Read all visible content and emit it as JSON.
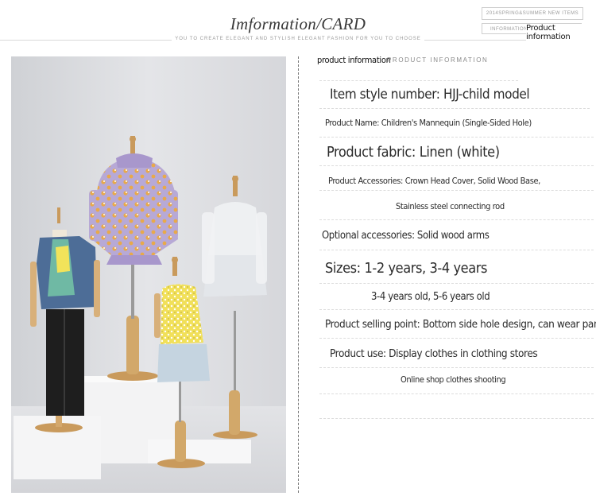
{
  "header": {
    "title": "Imformation/CARD",
    "subtitle": "YOU TO CREATE ELEGANT AND STYLISH ELEGANT FASHION FOR YOU TO CHOOSE",
    "season_tag": "2014SPRING&SUMMER NEW ITEMS",
    "info_tag": "INFORMATION",
    "info_tag_label": "Product information"
  },
  "section": {
    "label": "product information",
    "caps": "PRODUCT INFORMATION"
  },
  "details": {
    "style_number": "Item style number: HJJ-child model",
    "product_name": "Product Name: Children's Mannequin (Single-Sided Hole)",
    "fabric": "Product fabric: Linen (white)",
    "accessories_1": "Product Accessories: Crown Head Cover, Solid Wood Base,",
    "accessories_2": "Stainless steel connecting rod",
    "optional": "Optional accessories: Solid wood arms",
    "sizes": "Sizes: 1-2 years, 3-4 years",
    "sizes_note": "3-4 years old, 5-6 years old",
    "selling_point": "Product selling point: Bottom side hole design, can wear pants",
    "use": "Product use: Display clothes in clothing stores",
    "use_2": "Online shop clothes shooting"
  },
  "photo": {
    "description_icon": "mannequin-photo"
  },
  "colors": {
    "background": "#ffffff",
    "wall": "#dcdde0",
    "wood": "#d2a86a"
  }
}
